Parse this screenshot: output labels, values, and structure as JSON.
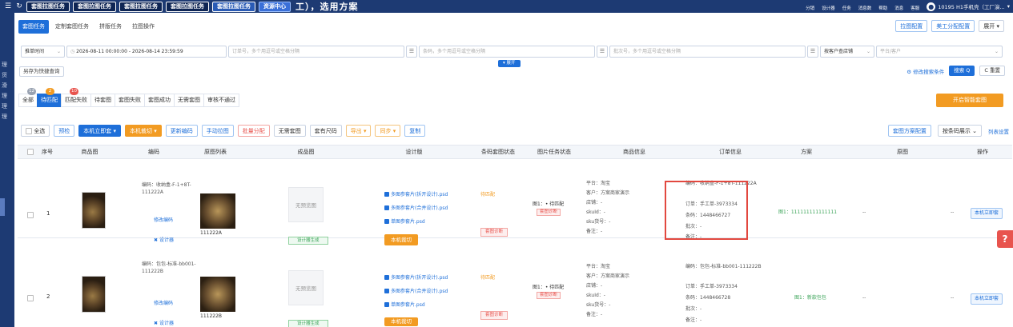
{
  "topbar": {
    "tabs": [
      "套图拉图任务",
      "套图拉图任务",
      "套图拉图任务",
      "套图拉图任务",
      "套图拉图任务"
    ],
    "resource_tab": "资源中心",
    "hint": "工），选用方案",
    "nav": [
      "分销",
      "设计器",
      "任务",
      "消息数",
      "帮助",
      "消息",
      "客服"
    ],
    "user_text": "10195 H1手机壳（工厂演..."
  },
  "leftnav": [
    "理",
    "货",
    "滑",
    "理",
    "理",
    "理"
  ],
  "tabs1": [
    "套图任务",
    "定制套图任务",
    "拼版任务",
    "拉图操作"
  ],
  "top_right": {
    "btn1": "拉图配置",
    "btn2": "美工分配配置",
    "btn3": "展开 ▾"
  },
  "filters": {
    "time_type": "推单时间",
    "start": "2026-08-11 00:00:00",
    "dash": "-",
    "end": "2026-08-14 23:59:59",
    "order_ph": "订单号，多个用逗号或空格分隔",
    "barcode_ph": "条码，多个用逗号或空格分隔",
    "batch_ph": "批次号，多个用逗号或空格分隔",
    "store_type": "按客户查店铺",
    "platform_ph": "平台/客户"
  },
  "expand": "▾ 展开",
  "quick_save": "另存为快捷查询",
  "search_right": {
    "edit": "修改搜索条件",
    "search": "搜索 Q",
    "reset": "C 重置"
  },
  "status_tabs": [
    {
      "label": "全部",
      "badge": "12"
    },
    {
      "label": "待匹配",
      "badge": "2"
    },
    {
      "label": "匹配失败",
      "badge": "10"
    },
    {
      "label": "待套图",
      "badge": ""
    },
    {
      "label": "套图失败",
      "badge": ""
    },
    {
      "label": "套图成功",
      "badge": ""
    },
    {
      "label": "无需套图",
      "badge": ""
    },
    {
      "label": "审核不通过",
      "badge": ""
    }
  ],
  "smart": "开启智能套图",
  "actions": {
    "select_all": "全选",
    "b1": "预检",
    "b2": "本机立即套 ▾",
    "b3": "本机裁切 ▾",
    "b4": "更新编码",
    "b5": "手动拉图",
    "b6": "批量分配",
    "b7": "无需套图",
    "b8": "套有尺码",
    "b9": "导出 ▾",
    "b10": "同步 ▾",
    "b11": "复制",
    "r1": "套图方案配置",
    "r2": "按条码展示",
    "col_setting": "列表设置"
  },
  "headers": [
    "序号",
    "商品图",
    "编码",
    "原图列表",
    "成品图",
    "设计版",
    "条码套图状态",
    "图片任务状态",
    "商品信息",
    "订单信息",
    "方案",
    "原图",
    "操作"
  ],
  "rows": [
    {
      "no": "1",
      "code": "编码：收纳盒-F-1+8T-111222A",
      "edit_code": "修改编码",
      "designer": "设计器",
      "orig_label": "111222A",
      "no_preview": "无预览图",
      "gen": "设计器生成",
      "files": [
        "多图参套片(拆开设计).psd",
        "多图参套片(合并设计).psd",
        "单图参套片.psd"
      ],
      "cut": "本机裁切",
      "barcode_status": "待匹配",
      "diag": "套图诊断",
      "task_status": "图1：• 待匹配",
      "task_diag": "套图诊断",
      "platform": "平台：淘宝",
      "customer": "客户：方案商家演示",
      "store": "店铺：-",
      "skuid": "skuId：-",
      "sku_code": "sku货号：-",
      "remark": "备注：-",
      "order_code": "编码：收纳盒-F-1+8T-111222A",
      "order_no": "订单：手工单-3973334",
      "barcode": "条码：1448466727",
      "batch": "批次：-",
      "order_remark": "备注：-",
      "plan": "图1：111111111111111",
      "orig": "--",
      "dash2": "--",
      "op": "本机立即套"
    },
    {
      "no": "2",
      "code": "编码：包包-标准-bb001-111222B",
      "edit_code": "修改编码",
      "designer": "设计器",
      "orig_label": "111222B",
      "no_preview": "无预览图",
      "gen": "设计器生成",
      "files": [
        "多图参套片(拆开设计).psd",
        "多图参套片(合并设计).psd",
        "单图参套片.psd"
      ],
      "cut": "本机裁切",
      "barcode_status": "待匹配",
      "diag": "套图诊断",
      "task_status": "图1：• 待匹配",
      "task_diag": "套图诊断",
      "platform": "平台：淘宝",
      "customer": "客户：方案商家演示",
      "store": "店铺：-",
      "skuid": "skuId：-",
      "sku_code": "sku货号：-",
      "remark": "备注：-",
      "order_code": "编码：包包-标准-bb001-111222B",
      "order_no": "订单：手工单-3973334",
      "barcode": "条码：1448466728",
      "batch": "批次：-",
      "order_remark": "备注：-",
      "plan": "图1：新款包包",
      "orig": "--",
      "dash2": "--",
      "op": "本机立即套"
    }
  ],
  "colors": {
    "brand": "#1e6fd9",
    "topbar": "#1d3a73",
    "orange": "#f29b22",
    "red": "#e8544e"
  }
}
